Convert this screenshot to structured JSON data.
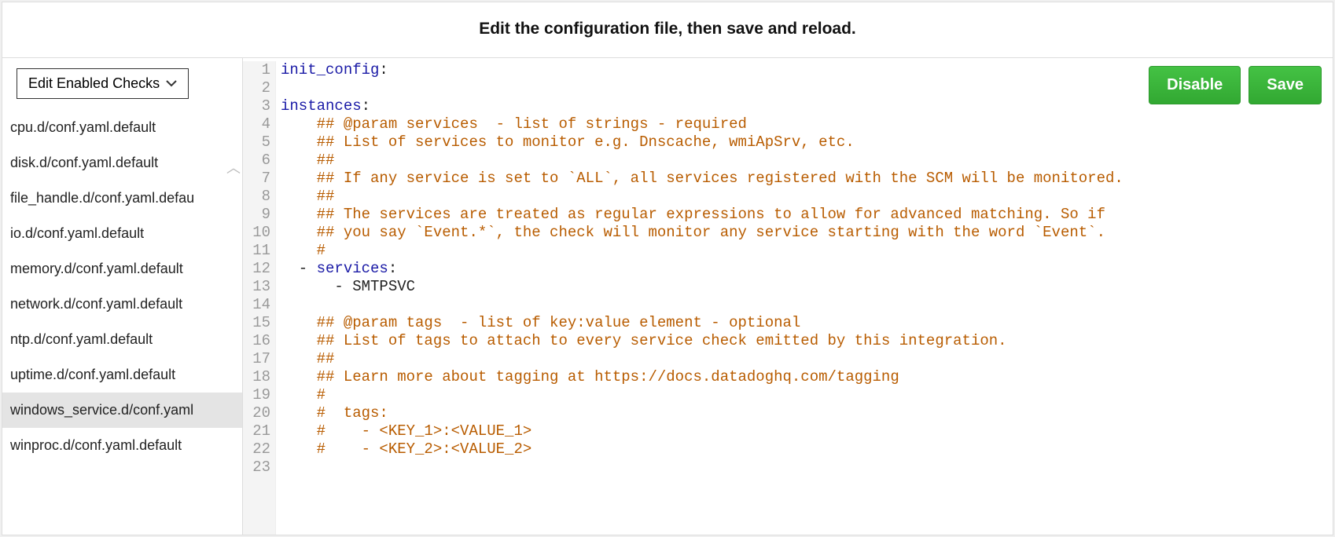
{
  "header": {
    "title": "Edit the configuration file, then save and reload."
  },
  "sidebar": {
    "dropdown_label": "Edit Enabled Checks",
    "files": [
      {
        "name": "cpu.d/conf.yaml.default",
        "selected": false
      },
      {
        "name": "disk.d/conf.yaml.default",
        "selected": false
      },
      {
        "name": "file_handle.d/conf.yaml.defau",
        "selected": false
      },
      {
        "name": "io.d/conf.yaml.default",
        "selected": false
      },
      {
        "name": "memory.d/conf.yaml.default",
        "selected": false
      },
      {
        "name": "network.d/conf.yaml.default",
        "selected": false
      },
      {
        "name": "ntp.d/conf.yaml.default",
        "selected": false
      },
      {
        "name": "uptime.d/conf.yaml.default",
        "selected": false
      },
      {
        "name": "windows_service.d/conf.yaml",
        "selected": true
      },
      {
        "name": "winproc.d/conf.yaml.default",
        "selected": false
      }
    ]
  },
  "actions": {
    "disable_label": "Disable",
    "save_label": "Save"
  },
  "editor": {
    "lines": [
      [
        {
          "cls": "tok-key",
          "t": "init_config"
        },
        {
          "cls": "tok-plain",
          "t": ":"
        }
      ],
      [],
      [
        {
          "cls": "tok-key",
          "t": "instances"
        },
        {
          "cls": "tok-plain",
          "t": ":"
        }
      ],
      [
        {
          "cls": "tok-cmt",
          "t": "    ## @param services  - list of strings - required"
        }
      ],
      [
        {
          "cls": "tok-cmt",
          "t": "    ## List of services to monitor e.g. Dnscache, wmiApSrv, etc."
        }
      ],
      [
        {
          "cls": "tok-cmt",
          "t": "    ##"
        }
      ],
      [
        {
          "cls": "tok-cmt",
          "t": "    ## If any service is set to `ALL`, all services registered with the SCM will be monitored."
        }
      ],
      [
        {
          "cls": "tok-cmt",
          "t": "    ##"
        }
      ],
      [
        {
          "cls": "tok-cmt",
          "t": "    ## The services are treated as regular expressions to allow for advanced matching. So if"
        }
      ],
      [
        {
          "cls": "tok-cmt",
          "t": "    ## you say `Event.*`, the check will monitor any service starting with the word `Event`."
        }
      ],
      [
        {
          "cls": "tok-cmt",
          "t": "    #"
        }
      ],
      [
        {
          "cls": "tok-plain",
          "t": "  - "
        },
        {
          "cls": "tok-key",
          "t": "services"
        },
        {
          "cls": "tok-plain",
          "t": ":"
        }
      ],
      [
        {
          "cls": "tok-plain",
          "t": "      - SMTPSVC"
        }
      ],
      [],
      [
        {
          "cls": "tok-cmt",
          "t": "    ## @param tags  - list of key:value element - optional"
        }
      ],
      [
        {
          "cls": "tok-cmt",
          "t": "    ## List of tags to attach to every service check emitted by this integration."
        }
      ],
      [
        {
          "cls": "tok-cmt",
          "t": "    ##"
        }
      ],
      [
        {
          "cls": "tok-cmt",
          "t": "    ## Learn more about tagging at https://docs.datadoghq.com/tagging"
        }
      ],
      [
        {
          "cls": "tok-cmt",
          "t": "    #"
        }
      ],
      [
        {
          "cls": "tok-cmt",
          "t": "    #  tags:"
        }
      ],
      [
        {
          "cls": "tok-cmt",
          "t": "    #    - <KEY_1>:<VALUE_1>"
        }
      ],
      [
        {
          "cls": "tok-cmt",
          "t": "    #    - <KEY_2>:<VALUE_2>"
        }
      ],
      []
    ]
  }
}
